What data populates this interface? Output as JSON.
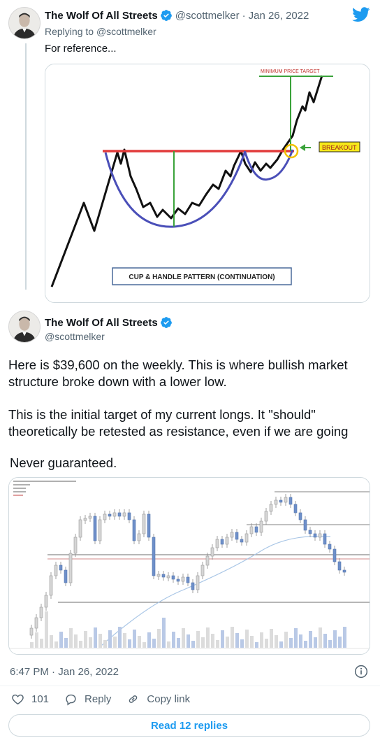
{
  "reply_tweet": {
    "display_name": "The Wolf Of All Streets",
    "handle": "@scottmelker",
    "separator": "·",
    "date": "Jan 26, 2022",
    "replying_prefix": "Replying to",
    "replying_to": "@scottmelker",
    "text": "For reference...",
    "image": {
      "target_label": "MINIMUM PRICE TARGET",
      "breakout_label": "BREAKOUT",
      "pattern_label": "CUP & HANDLE PATTERN (CONTINUATION)"
    }
  },
  "main_tweet": {
    "display_name": "The Wolf Of All Streets",
    "handle": "@scottmelker",
    "paragraph_1": "Here is $39,600 on the weekly. This is where bullish market structure broke down with a lower low.",
    "paragraph_2": "This is the initial target of my current longs. It \"should\" theoretically be retested as resistance, even if we are going",
    "paragraph_3": "Never guaranteed.",
    "timestamp": "6:47 PM · Jan 26, 2022"
  },
  "engagement": {
    "like_count": "101",
    "reply_label": "Reply",
    "copy_link_label": "Copy link",
    "read_replies_label": "Read 12 replies"
  },
  "colors": {
    "accent": "#1d9bf0",
    "secondary_text": "#536471",
    "border": "#cfd9de",
    "resistance_red": "#e23b3b",
    "cup_blue": "#4a4fb8",
    "target_green": "#3aa33a"
  },
  "icons": [
    "verified-badge-icon",
    "twitter-bird-icon",
    "info-icon",
    "heart-icon",
    "reply-bubble-icon",
    "link-icon"
  ]
}
